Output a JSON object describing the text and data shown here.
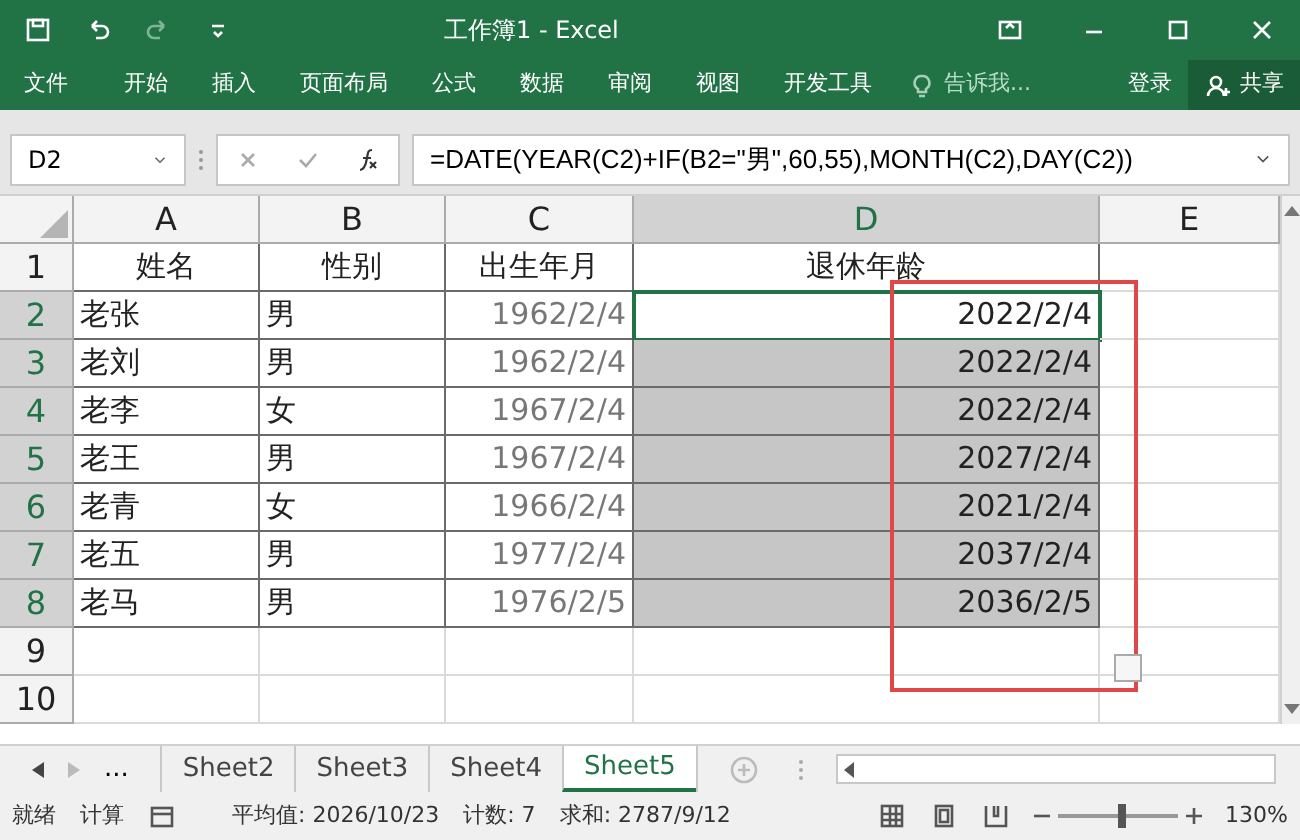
{
  "window": {
    "title": "工作簿1 - Excel"
  },
  "ribbon": {
    "tabs": [
      {
        "label": "文件",
        "selected": false
      },
      {
        "label": "开始",
        "selected": false
      },
      {
        "label": "插入",
        "selected": false
      },
      {
        "label": "页面布局",
        "selected": false
      },
      {
        "label": "公式",
        "selected": false
      },
      {
        "label": "数据",
        "selected": false
      },
      {
        "label": "审阅",
        "selected": false
      },
      {
        "label": "视图",
        "selected": false
      },
      {
        "label": "开发工具",
        "selected": false
      }
    ],
    "tell_me": {
      "placeholder": "告诉我..."
    },
    "sign_in": "登录",
    "share": "共享"
  },
  "formula_bar": {
    "name_box": "D2",
    "formula": "=DATE(YEAR(C2)+IF(B2=\"男\",60,55),MONTH(C2),DAY(C2))"
  },
  "columns": [
    {
      "label": "A",
      "selected": false
    },
    {
      "label": "B",
      "selected": false
    },
    {
      "label": "C",
      "selected": false
    },
    {
      "label": "D",
      "selected": true
    },
    {
      "label": "E",
      "selected": false
    }
  ],
  "rows": [
    {
      "number": "1",
      "selected": false,
      "active": false,
      "cells": [
        "姓名",
        "性别",
        "出生年月",
        "退休年龄",
        ""
      ]
    },
    {
      "number": "2",
      "selected": true,
      "active": true,
      "cells": [
        "老张",
        "男",
        "1962/2/4",
        "2022/2/4",
        ""
      ]
    },
    {
      "number": "3",
      "selected": true,
      "active": false,
      "cells": [
        "老刘",
        "男",
        "1962/2/4",
        "2022/2/4",
        ""
      ]
    },
    {
      "number": "4",
      "selected": true,
      "active": false,
      "cells": [
        "老李",
        "女",
        "1967/2/4",
        "2022/2/4",
        ""
      ]
    },
    {
      "number": "5",
      "selected": true,
      "active": false,
      "cells": [
        "老王",
        "男",
        "1967/2/4",
        "2027/2/4",
        ""
      ]
    },
    {
      "number": "6",
      "selected": true,
      "active": false,
      "cells": [
        "老青",
        "女",
        "1966/2/4",
        "2021/2/4",
        ""
      ]
    },
    {
      "number": "7",
      "selected": true,
      "active": false,
      "cells": [
        "老五",
        "男",
        "1977/2/4",
        "2037/2/4",
        ""
      ]
    },
    {
      "number": "8",
      "selected": true,
      "active": false,
      "cells": [
        "老马",
        "男",
        "1976/2/5",
        "2036/2/5",
        ""
      ]
    },
    {
      "number": "9",
      "selected": false,
      "active": false,
      "cells": [
        "",
        "",
        "",
        "",
        ""
      ]
    },
    {
      "number": "10",
      "selected": false,
      "active": false,
      "cells": [
        "",
        "",
        "",
        "",
        ""
      ]
    }
  ],
  "sheet_tabs": {
    "overflow": "...",
    "tabs": [
      {
        "label": "Sheet2",
        "selected": false
      },
      {
        "label": "Sheet3",
        "selected": false
      },
      {
        "label": "Sheet4",
        "selected": false
      },
      {
        "label": "Sheet5",
        "selected": true
      }
    ]
  },
  "status_bar": {
    "mode": "就绪",
    "calc": "计算",
    "average": "平均值: 2026/10/23",
    "count": "计数: 7",
    "sum": "求和: 2787/9/12",
    "zoom": "130%",
    "zoom_level": {
      "level": 0.55
    }
  }
}
